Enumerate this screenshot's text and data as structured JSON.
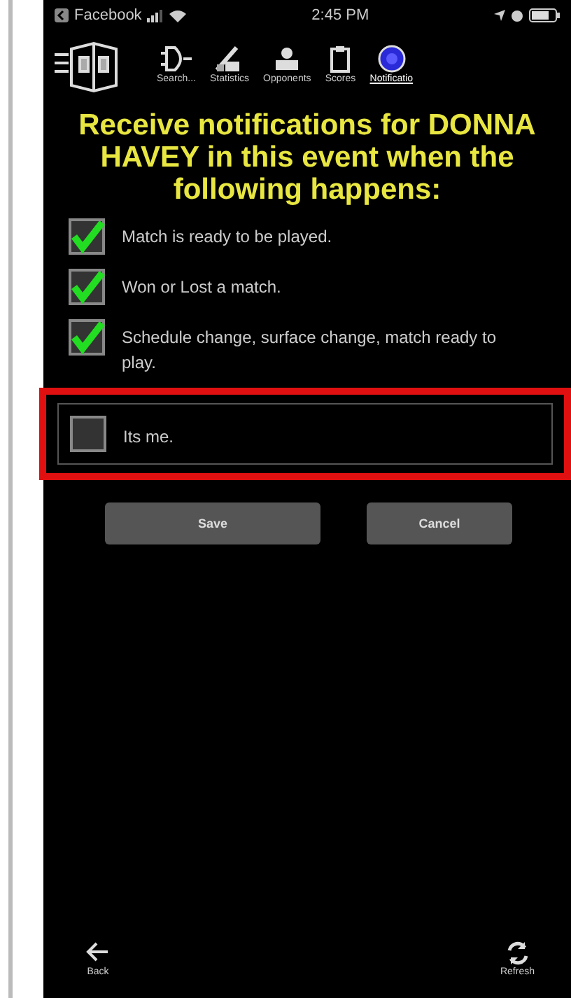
{
  "status_bar": {
    "back_app": "Facebook",
    "time": "2:45 PM"
  },
  "tabs": [
    {
      "label": "Search...",
      "kind": "gate",
      "selected": false
    },
    {
      "label": "Statistics",
      "kind": "stats",
      "selected": false
    },
    {
      "label": "Opponents",
      "kind": "people",
      "selected": false
    },
    {
      "label": "Scores",
      "kind": "clipboard",
      "selected": false
    },
    {
      "label": "Notificatio",
      "kind": "bell",
      "selected": true
    }
  ],
  "heading": "Receive notifications for DONNA HAVEY in this event when the following happens:",
  "options": [
    {
      "label": "Match is ready to be played.",
      "checked": true,
      "highlighted": false
    },
    {
      "label": "Won or Lost a match.",
      "checked": true,
      "highlighted": false
    },
    {
      "label": "Schedule change, surface change, match ready to play.",
      "checked": true,
      "highlighted": false
    },
    {
      "label": "Its me.",
      "checked": false,
      "highlighted": true
    }
  ],
  "buttons": [
    "Save",
    "Cancel"
  ],
  "bottom_bar": [
    {
      "label": "Back",
      "kind": "back"
    },
    {
      "label": "Refresh",
      "kind": "refresh"
    }
  ]
}
